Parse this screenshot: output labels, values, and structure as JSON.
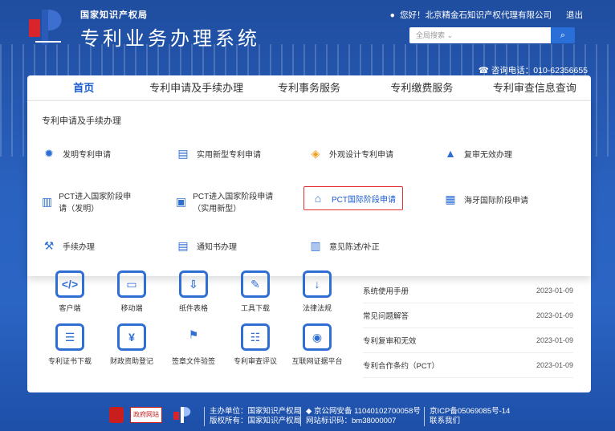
{
  "header": {
    "org": "国家知识产权局",
    "system_name": "专利业务办理系统",
    "greeting": "您好！北京精金石知识产权代理有限公司",
    "logout": "退出",
    "search_placeholder": "全局搜索",
    "phone": "咨询电话：010-62356655"
  },
  "nav": [
    "首页",
    "专利申请及手续办理",
    "专利事务服务",
    "专利缴费服务",
    "专利审查信息查询"
  ],
  "dropdown": {
    "title": "专利申请及手续办理",
    "items": [
      "发明专利申请",
      "实用新型专利申请",
      "外观设计专利申请",
      "复审无效办理",
      "PCT进入国家阶段申请（发明）",
      "PCT进入国家阶段申请（实用新型）",
      "PCT国际阶段申请",
      "海牙国际阶段申请",
      "手续办理",
      "通知书办理",
      "意见陈述/补正"
    ]
  },
  "tools": [
    "客户端",
    "移动端",
    "纸件表格",
    "工具下载",
    "法律法规",
    "专利证书下载",
    "财政资助登记",
    "签章文件验签",
    "专利审查评议",
    "互联网证据平台"
  ],
  "notices": [
    {
      "title": "系统使用手册",
      "date": "2023-01-09"
    },
    {
      "title": "常见问题解答",
      "date": "2023-01-09"
    },
    {
      "title": "专利复审和无效",
      "date": "2023-01-09"
    },
    {
      "title": "专利合作条约（PCT）",
      "date": "2023-01-09"
    }
  ],
  "footer": {
    "sponsor": "主办单位：国家知识产权局",
    "copyright": "版权所有：国家知识产权局",
    "police": "京公网安备 11040102700058号",
    "site_id": "网站标识码：bm38000007",
    "icp": "京ICP备05069085号-14",
    "contact": "联系我们",
    "gov_badge": "政府网站"
  }
}
